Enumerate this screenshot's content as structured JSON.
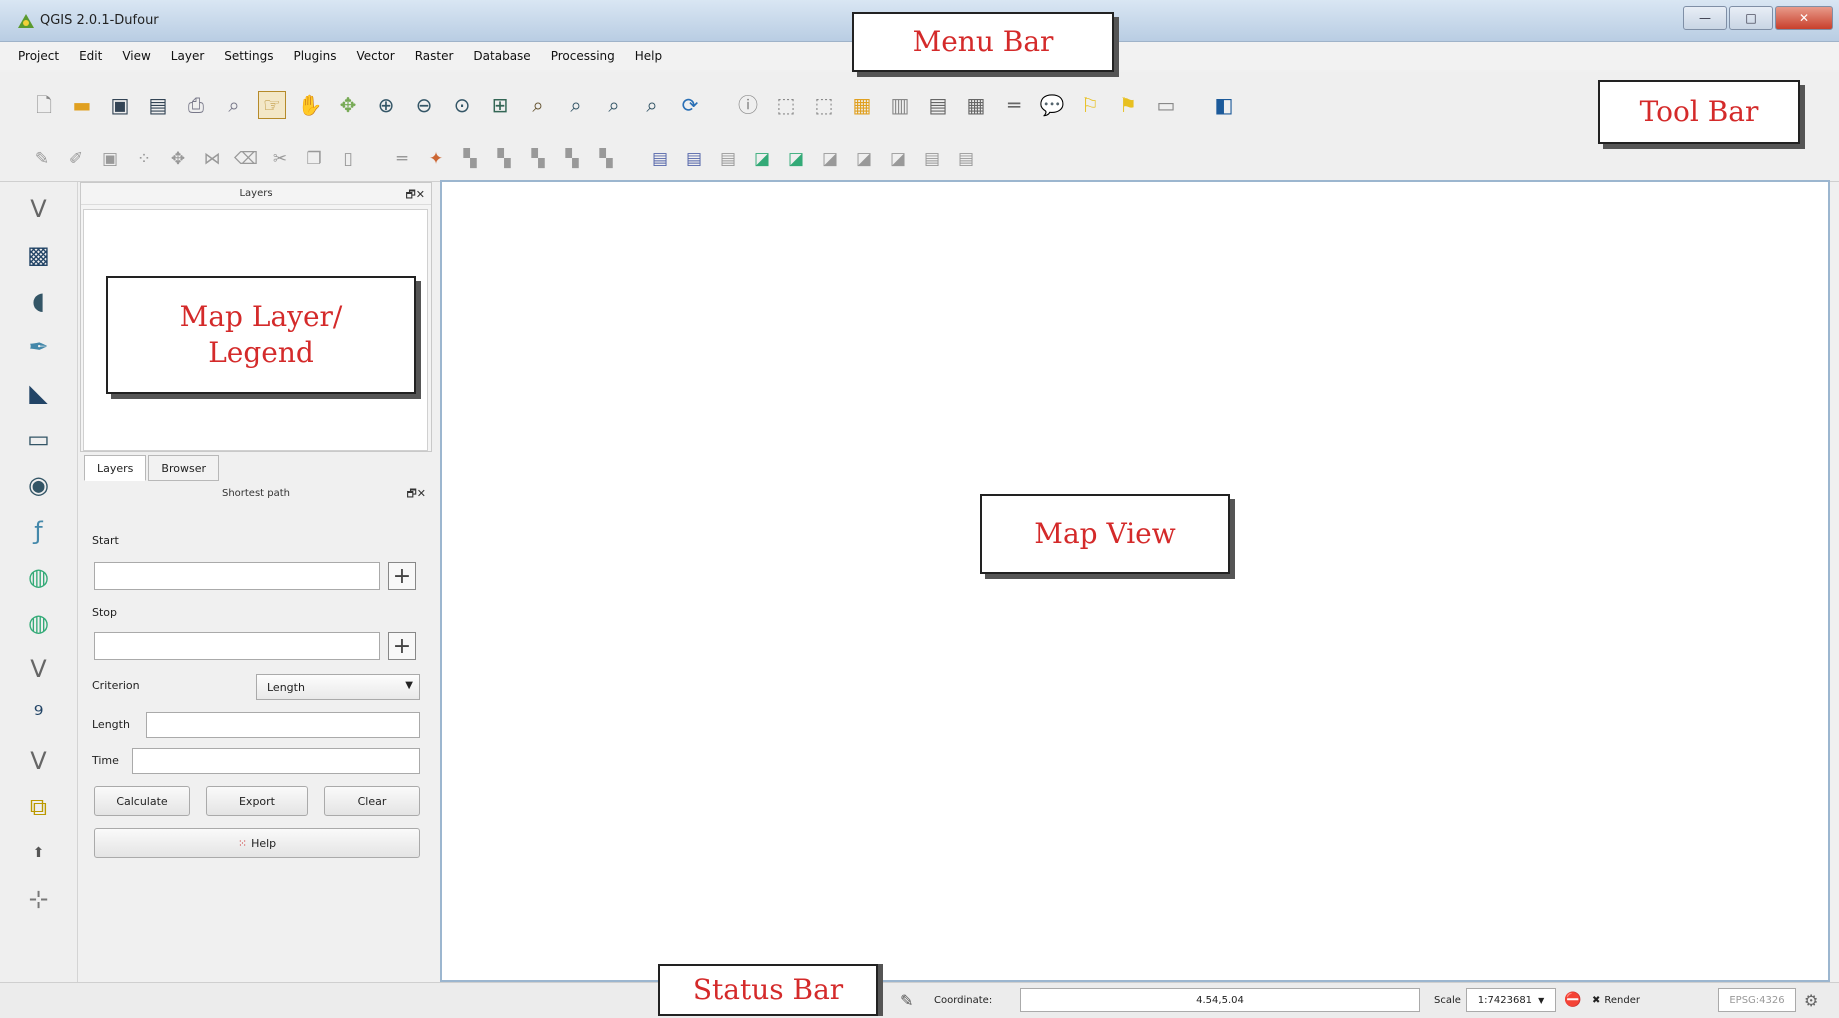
{
  "window": {
    "title": "QGIS 2.0.1-Dufour",
    "minimize_glyph": "—",
    "maximize_glyph": "□",
    "close_glyph": "✕"
  },
  "menu": {
    "items": [
      "Project",
      "Edit",
      "View",
      "Layer",
      "Settings",
      "Plugins",
      "Vector",
      "Raster",
      "Database",
      "Processing",
      "Help"
    ]
  },
  "toolbar": {
    "row1_icons": [
      "new-project-icon",
      "open-project-icon",
      "save-project-icon",
      "save-as-icon",
      "print-composer-icon",
      "composer-manager-icon",
      "touch-zoom-icon",
      "pan-icon",
      "pan-to-selection-icon",
      "zoom-in-icon",
      "zoom-out-icon",
      "zoom-full-icon",
      "zoom-layer-icon",
      "zoom-selection-icon",
      "zoom-last-icon",
      "zoom-next-icon",
      "zoom-native-icon",
      "refresh-icon",
      "identify-icon",
      "select-icon",
      "deselect-icon",
      "attribute-table-icon",
      "field-calculator-icon",
      "measure-icon",
      "annotation-icon",
      "tip-icon",
      "label-icon",
      "pin-label-icon",
      "layer-style-icon",
      "help-book-icon"
    ],
    "row2_icons": [
      "current-edits-icon",
      "toggle-editing-icon",
      "save-edits-icon",
      "add-feature-icon",
      "move-feature-icon",
      "node-tool-icon",
      "delete-selected-icon",
      "cut-features-icon",
      "copy-features-icon",
      "paste-features-icon",
      "undo-icon",
      "redo-icon",
      "label-tool-icon",
      "rotate-label-icon",
      "change-label-icon",
      "show-hide-label-icon",
      "move-label-icon",
      "wms-icon",
      "wfs-icon",
      "wcs-icon",
      "add-vector-icon",
      "add-raster-icon",
      "add-postgis-icon",
      "add-spatialite-icon",
      "add-mssql-icon",
      "add-oracle-icon",
      "add-delimited-icon",
      "add-virtual-icon"
    ]
  },
  "left_toolbar": {
    "icons": [
      "add-vector-layer-icon",
      "add-raster-layer-icon",
      "add-postgis-layer-icon",
      "add-spatialite-layer-icon",
      "add-mssql-layer-icon",
      "add-oracle-layer-icon",
      "add-wms-layer-icon",
      "add-wcs-layer-icon",
      "add-wfs-layer-icon",
      "add-delimited-text-icon",
      "add-virtual-layer-icon",
      "new-shapefile-icon",
      "new-spatialite-icon",
      "gps-tools-icon",
      "coordinate-capture-icon",
      "north-arrow-icon"
    ]
  },
  "layers_panel": {
    "title": "Layers",
    "controls": "🗗✕"
  },
  "tabs": [
    "Layers",
    "Browser"
  ],
  "shortest_path": {
    "title": "Shortest path",
    "controls": "🗗✕",
    "start_label": "Start",
    "stop_label": "Stop",
    "criterion_label": "Criterion",
    "criterion_value": "Length",
    "length_label": "Length",
    "time_label": "Time",
    "start_value": "",
    "stop_value": "",
    "length_value": "",
    "time_value": "",
    "calculate_label": "Calculate",
    "export_label": "Export",
    "clear_label": "Clear",
    "help_label": "Help"
  },
  "status": {
    "coordinate_label": "Coordinate:",
    "coordinate_value": "4.54,5.04",
    "scale_label": "Scale",
    "scale_value": "1:7423681",
    "render_label": "Render",
    "crs_value": "EPSG:4326"
  },
  "annotations": {
    "menu_bar": "Menu Bar",
    "tool_bar": "Tool Bar",
    "map_layer_legend": "Map Layer/ Legend",
    "map_view": "Map View",
    "status_bar": "Status Bar"
  },
  "colors": {
    "accent": "#d42a2a",
    "map_border": "#9cb6cf"
  }
}
